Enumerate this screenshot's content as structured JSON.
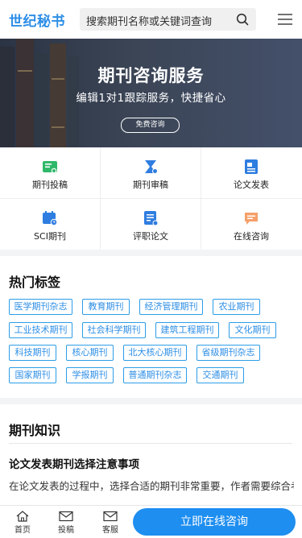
{
  "header": {
    "logo": "世纪秘书",
    "search_placeholder": "搜索期刊名称或关键词查询",
    "search_icon": "search-icon",
    "menu_icon": "menu-icon"
  },
  "banner": {
    "title": "期刊咨询服务",
    "subtitle": "编辑1对1跟踪服务，快捷省心",
    "button": "免费咨询"
  },
  "services": [
    {
      "label": "期刊投稿",
      "icon": "certificate-icon",
      "color": "#2fb86a"
    },
    {
      "label": "期刊审稿",
      "icon": "review-icon",
      "color": "#2f7de0"
    },
    {
      "label": "论文发表",
      "icon": "document-icon",
      "color": "#2f7de0"
    },
    {
      "label": "SCI期刊",
      "icon": "calendar-icon",
      "color": "#2f7de0"
    },
    {
      "label": "评职论文",
      "icon": "report-icon",
      "color": "#2f7de0"
    },
    {
      "label": "在线咨询",
      "icon": "chat-icon",
      "color": "#f5a06a"
    }
  ],
  "topics": {
    "title": "热门标签",
    "tags": [
      "医学期刊杂志",
      "教育期刊",
      "经济管理期刊",
      "农业期刊",
      "工业技术期刊",
      "社会科学期刊",
      "建筑工程期刊",
      "文化期刊",
      "科技期刊",
      "核心期刊",
      "北大核心期刊",
      "省级期刊杂志",
      "国家期刊",
      "学报期刊",
      "普通期刊杂志",
      "交通期刊"
    ]
  },
  "articles": {
    "title": "期刊知识",
    "headline": "论文发表期刊选择注意事项",
    "excerpt": "在论文发表的过程中，选择合适的期刊非常重要，作者需要综合考虑期刊的级别、影响因子和审稿周期等多方面因素。"
  },
  "bottom_nav": {
    "items": [
      {
        "label": "首页",
        "icon": "home-icon"
      },
      {
        "label": "投稿",
        "icon": "mail-icon"
      },
      {
        "label": "客服",
        "icon": "mail-icon"
      }
    ],
    "cta": "立即在线咨询"
  },
  "colors": {
    "brand": "#2c8ee6",
    "cta": "#1e8ef0"
  }
}
